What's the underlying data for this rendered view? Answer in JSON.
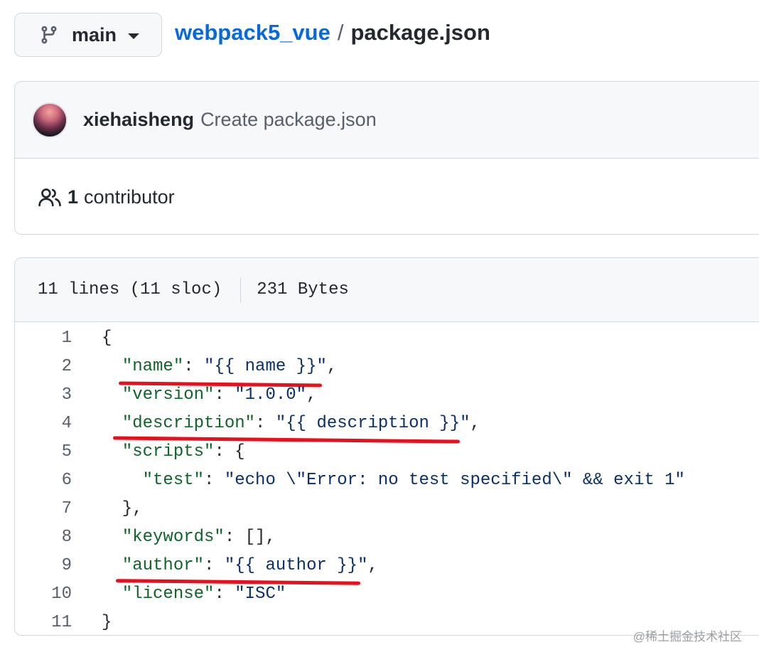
{
  "branch": {
    "name": "main"
  },
  "breadcrumb": {
    "repo": "webpack5_vue",
    "separator": "/",
    "file": "package.json"
  },
  "commit": {
    "author": "xiehaisheng",
    "message": "Create package.json"
  },
  "contributors": {
    "count": "1",
    "label": "contributor"
  },
  "file_info": {
    "lines": "11 lines (11 sloc)",
    "size": "231 Bytes"
  },
  "code": {
    "line_numbers": [
      "1",
      "2",
      "3",
      "4",
      "5",
      "6",
      "7",
      "8",
      "9",
      "10",
      "11"
    ],
    "l1": "{",
    "l2": {
      "indent": "  ",
      "key": "\"name\"",
      "colon": ": ",
      "value": "\"{{ name }}\"",
      "end": ","
    },
    "l3": {
      "indent": "  ",
      "key": "\"version\"",
      "colon": ": ",
      "value": "\"1.0.0\"",
      "end": ","
    },
    "l4": {
      "indent": "  ",
      "key": "\"description\"",
      "colon": ": ",
      "value": "\"{{ description }}\"",
      "end": ","
    },
    "l5": {
      "indent": "  ",
      "key": "\"scripts\"",
      "colon": ": ",
      "value": "{"
    },
    "l6": {
      "indent": "    ",
      "key": "\"test\"",
      "colon": ": ",
      "value": "\"echo \\\"Error: no test specified\\\" && exit 1\""
    },
    "l7": "  },",
    "l8": {
      "indent": "  ",
      "key": "\"keywords\"",
      "colon": ": ",
      "value": "[]",
      "end": ","
    },
    "l9": {
      "indent": "  ",
      "key": "\"author\"",
      "colon": ": ",
      "value": "\"{{ author }}\"",
      "end": ","
    },
    "l10": {
      "indent": "  ",
      "key": "\"license\"",
      "colon": ": ",
      "value": "\"ISC\""
    },
    "l11": "}"
  },
  "watermark": "@稀土掘金技术社区",
  "colors": {
    "link": "#0969da",
    "json_key": "#116329",
    "json_string": "#0a3069",
    "annotation_underline": "#e8101c"
  }
}
